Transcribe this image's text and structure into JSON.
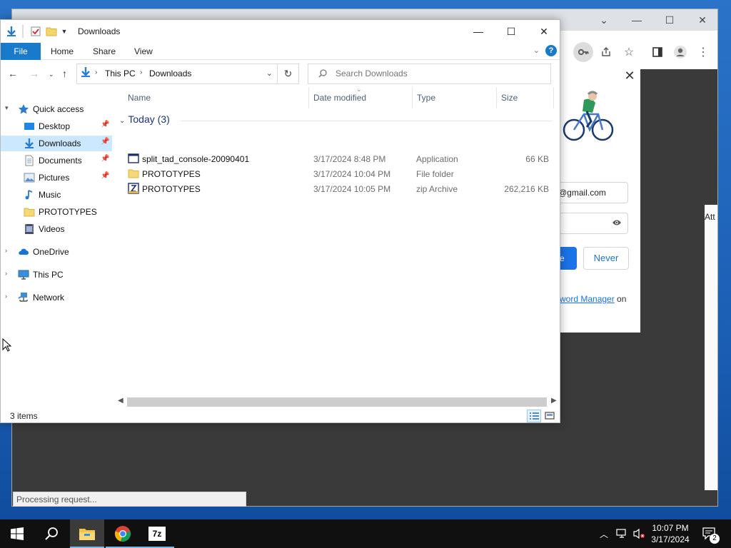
{
  "chrome": {
    "page_strip_text": "Att",
    "password_popup": {
      "email_value": "@gmail.com",
      "save_label": "e",
      "never_label": "Never",
      "pm_link": "word Manager",
      "pm_suffix": " on"
    }
  },
  "explorer": {
    "title": "Downloads",
    "ribbon_tabs": [
      "File",
      "Home",
      "Share",
      "View"
    ],
    "help": "?",
    "breadcrumb": [
      "This PC",
      "Downloads"
    ],
    "search_placeholder": "Search Downloads",
    "nav": {
      "quick_access": "Quick access",
      "items": [
        {
          "label": "Desktop",
          "icon": "desktop-icon",
          "pinned": true
        },
        {
          "label": "Downloads",
          "icon": "downloads-icon",
          "pinned": true,
          "selected": true
        },
        {
          "label": "Documents",
          "icon": "documents-icon",
          "pinned": true
        },
        {
          "label": "Pictures",
          "icon": "pictures-icon",
          "pinned": true
        },
        {
          "label": "Music",
          "icon": "music-icon",
          "pinned": false
        },
        {
          "label": "PROTOTYPES",
          "icon": "folder-icon",
          "pinned": false
        },
        {
          "label": "Videos",
          "icon": "videos-icon",
          "pinned": false
        }
      ],
      "onedrive": "OneDrive",
      "this_pc": "This PC",
      "network": "Network"
    },
    "columns": [
      "Name",
      "Date modified",
      "Type",
      "Size"
    ],
    "group": "Today (3)",
    "files": [
      {
        "name": "split_tad_console-20090401",
        "date": "3/17/2024 8:48 PM",
        "type": "Application",
        "size": "66 KB",
        "icon": "application-icon"
      },
      {
        "name": "PROTOTYPES",
        "date": "3/17/2024 10:04 PM",
        "type": "File folder",
        "size": "",
        "icon": "folder-icon"
      },
      {
        "name": "PROTOTYPES",
        "date": "3/17/2024 10:05 PM",
        "type": "zip Archive",
        "size": "262,216 KB",
        "icon": "zip-icon"
      }
    ],
    "status": "3 items"
  },
  "processing": "Processing request...",
  "taskbar": {
    "clock_time": "10:07 PM",
    "clock_date": "3/17/2024",
    "notification_count": "2",
    "sevenzip_label": "7z"
  }
}
